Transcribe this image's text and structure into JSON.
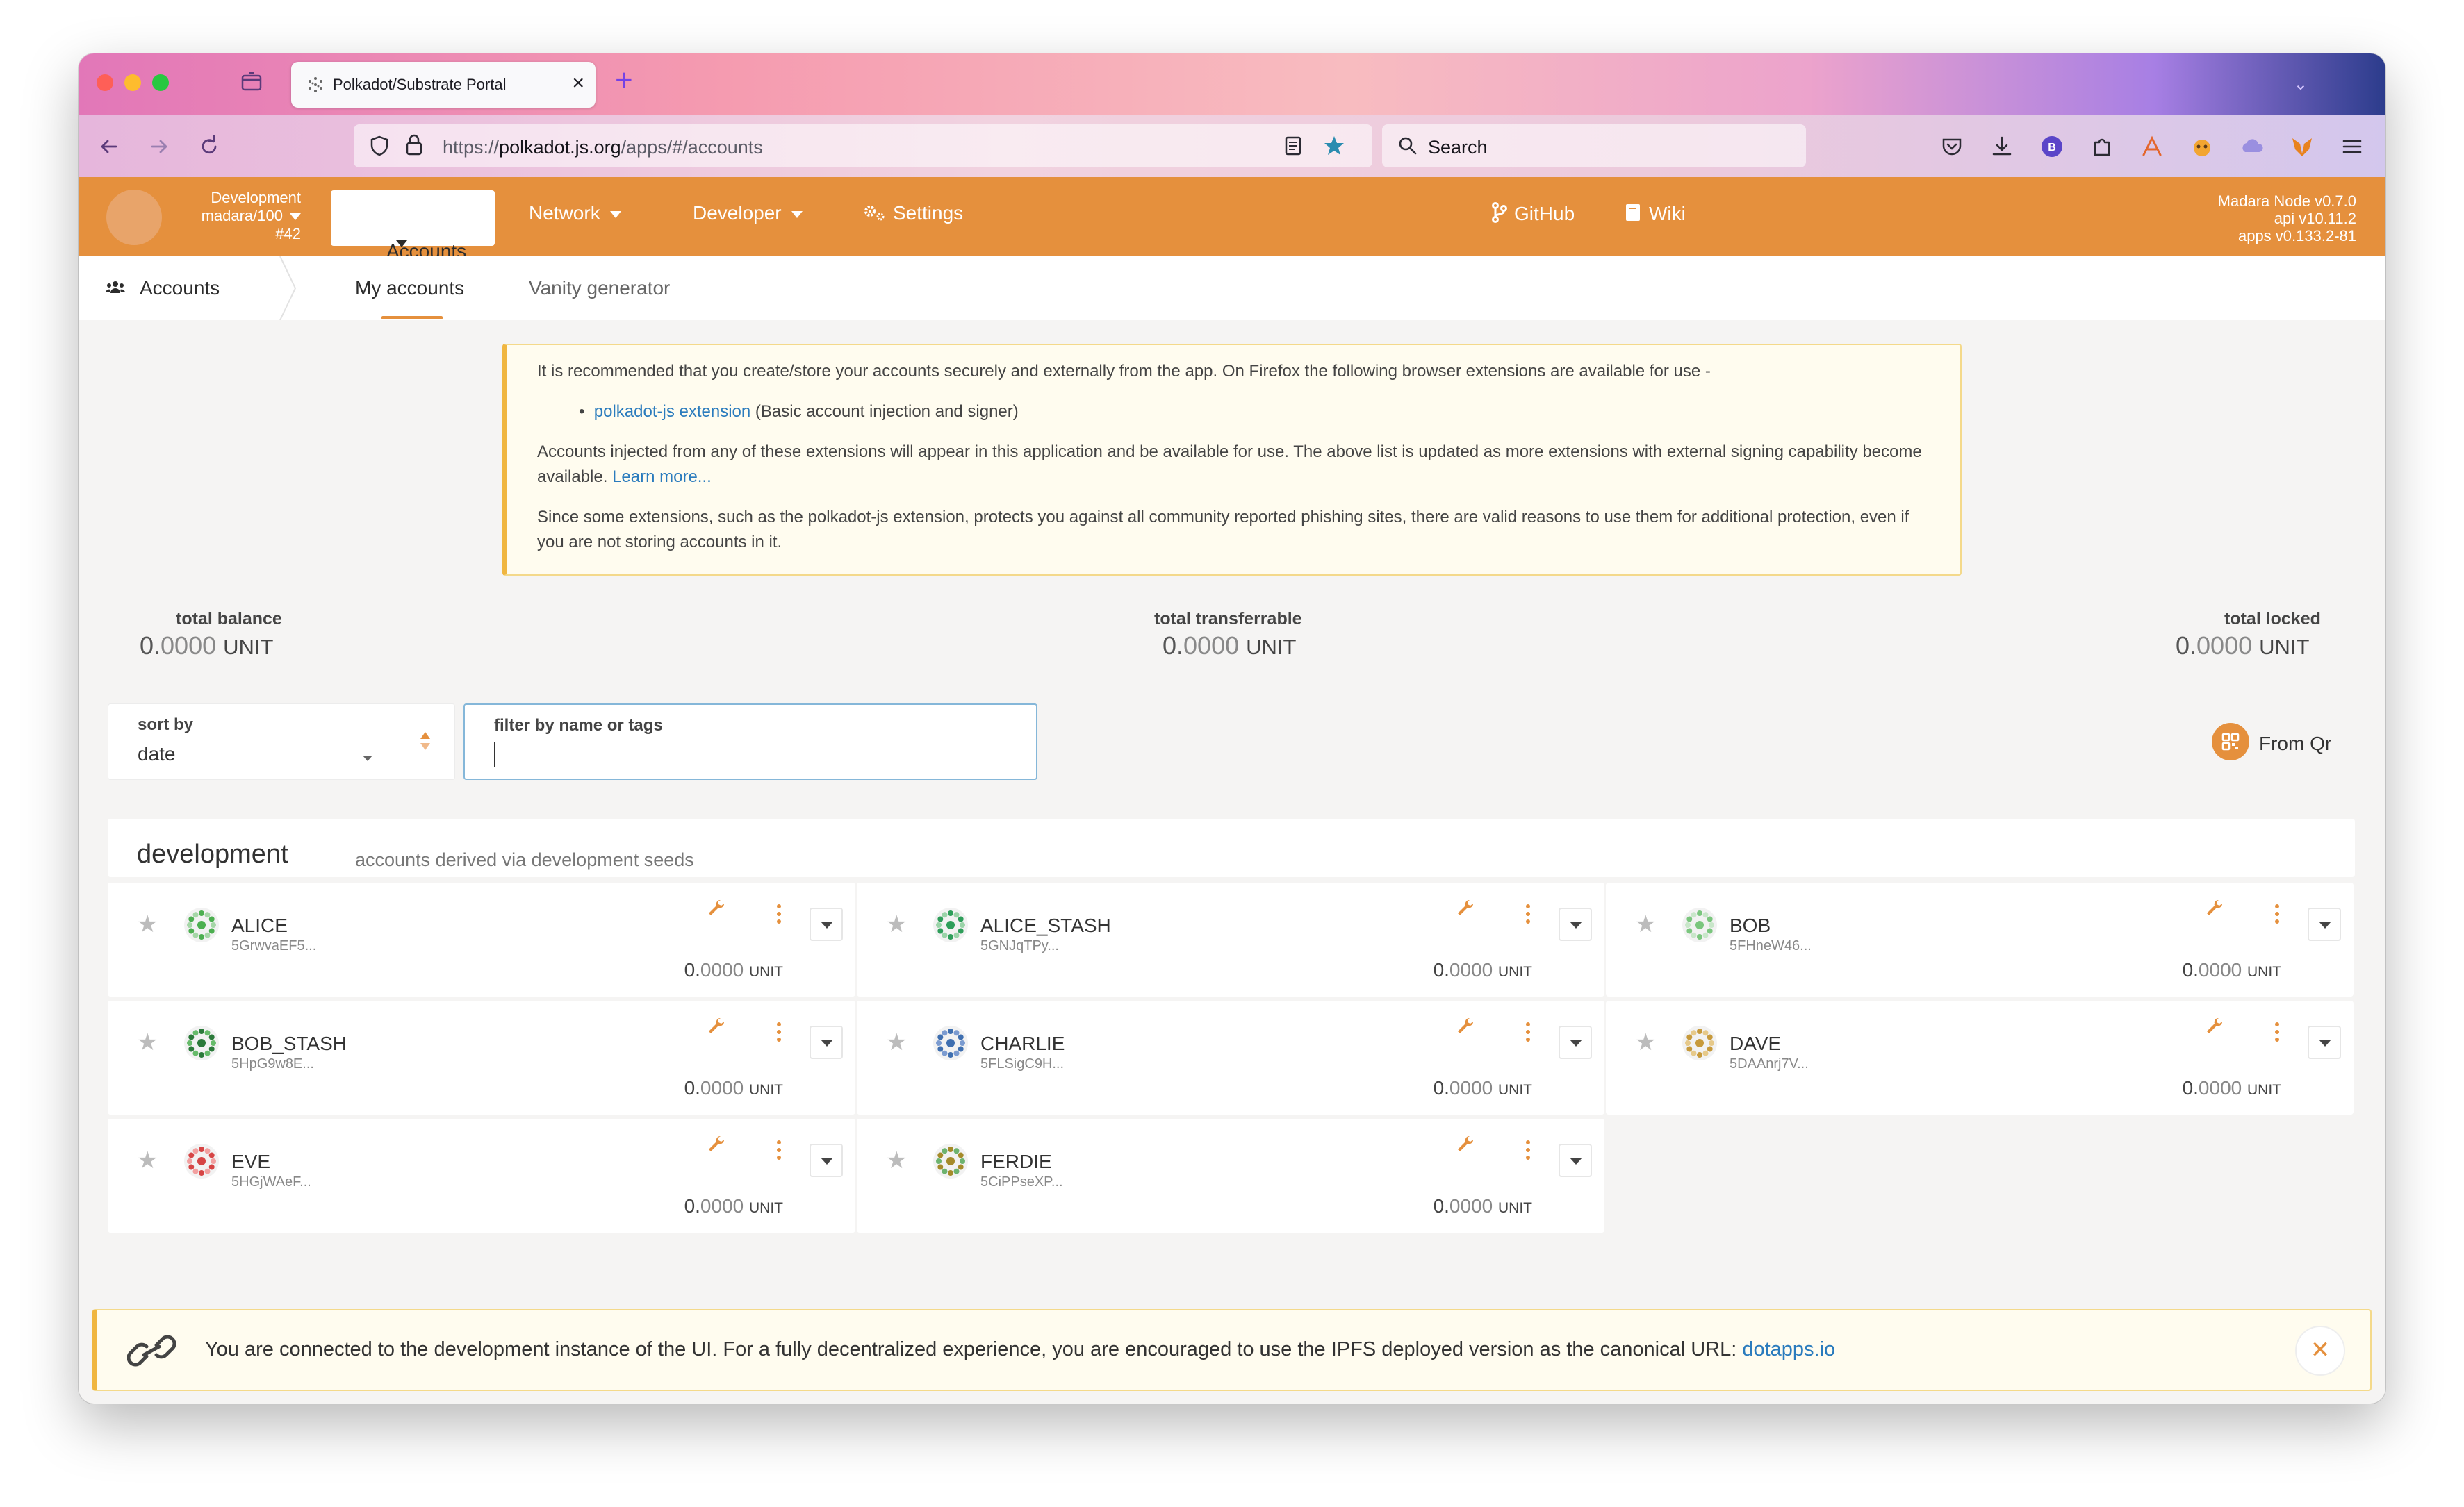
{
  "browser": {
    "tab_title": "Polkadot/Substrate Portal",
    "url_prefix": "https://",
    "url_host": "polkadot.js.org",
    "url_path": "/apps/#/accounts",
    "search_placeholder": "Search"
  },
  "header": {
    "chain_name": "Development",
    "chain_spec": "madara/100",
    "block": "#42",
    "menu": {
      "accounts": "Accounts",
      "network": "Network",
      "developer": "Developer",
      "settings": "Settings",
      "github": "GitHub",
      "wiki": "Wiki"
    },
    "node_info": {
      "node": "Madara Node v0.7.0",
      "api": "api v10.11.2",
      "apps": "apps v0.133.2-81"
    }
  },
  "subnav": {
    "crumb": "Accounts",
    "tabs": [
      "My accounts",
      "Vanity generator"
    ]
  },
  "notice": {
    "intro": "It is recommended that you create/store your accounts securely and externally from the app. On Firefox the following browser extensions are available for use -",
    "ext_link": "polkadot-js extension",
    "ext_desc": "(Basic account injection and signer)",
    "para2": "Accounts injected from any of these extensions will appear in this application and be available for use. The above list is updated as more extensions with external signing capability become available.",
    "learn_more": "Learn more...",
    "para3": "Since some extensions, such as the polkadot-js extension, protects you against all community reported phishing sites, there are valid reasons to use them for additional protection, even if you are not storing accounts in it."
  },
  "summary": {
    "total_balance_label": "total balance",
    "total_balance_int": "0.",
    "total_balance_dec": "0000",
    "total_transferrable_label": "total transferrable",
    "total_transferrable_int": "0.",
    "total_transferrable_dec": "0000",
    "total_locked_label": "total locked",
    "total_locked_int": "0.",
    "total_locked_dec": "0000",
    "unit": "UNIT"
  },
  "filters": {
    "sort_label": "sort by",
    "sort_value": "date",
    "filter_label": "filter by name or tags",
    "filter_value": "",
    "from_qr": "From Qr"
  },
  "group": {
    "title": "development",
    "subtitle": "accounts derived via development seeds"
  },
  "accounts": [
    {
      "name": "ALICE",
      "address": "5GrwvaEF5...",
      "balance_int": "0.",
      "balance_dec": "0000",
      "unit": "UNIT"
    },
    {
      "name": "ALICE_STASH",
      "address": "5GNJqTPy...",
      "balance_int": "0.",
      "balance_dec": "0000",
      "unit": "UNIT"
    },
    {
      "name": "BOB",
      "address": "5FHneW46...",
      "balance_int": "0.",
      "balance_dec": "0000",
      "unit": "UNIT"
    },
    {
      "name": "BOB_STASH",
      "address": "5HpG9w8E...",
      "balance_int": "0.",
      "balance_dec": "0000",
      "unit": "UNIT"
    },
    {
      "name": "CHARLIE",
      "address": "5FLSigC9H...",
      "balance_int": "0.",
      "balance_dec": "0000",
      "unit": "UNIT"
    },
    {
      "name": "DAVE",
      "address": "5DAAnrj7V...",
      "balance_int": "0.",
      "balance_dec": "0000",
      "unit": "UNIT"
    },
    {
      "name": "EVE",
      "address": "5HGjWAeF...",
      "balance_int": "0.",
      "balance_dec": "0000",
      "unit": "UNIT"
    },
    {
      "name": "FERDIE",
      "address": "5CiPPseXP...",
      "balance_int": "0.",
      "balance_dec": "0000",
      "unit": "UNIT"
    }
  ],
  "banner": {
    "text": "You are connected to the development instance of the UI. For a fully decentralized experience, you are encouraged to use the IPFS deployed version as the canonical URL:",
    "link": "dotapps.io",
    "close": "✕"
  },
  "colors": {
    "accent": "#e5903d",
    "link": "#2a7bbd",
    "notice_bg": "#fffcef",
    "notice_border": "#f0b640"
  }
}
